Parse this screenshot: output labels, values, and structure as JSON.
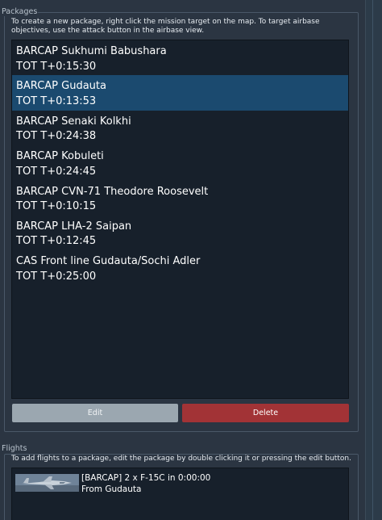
{
  "packages": {
    "group_title": "Packages",
    "hint": "To create a new package, right click the mission target on the map. To target airbase objectives, use the attack button in the airbase view.",
    "selected_index": 1,
    "items": [
      {
        "name": "BARCAP Sukhumi Babushara",
        "tot": "TOT T+0:15:30"
      },
      {
        "name": "BARCAP Gudauta",
        "tot": "TOT T+0:13:53"
      },
      {
        "name": "BARCAP Senaki Kolkhi",
        "tot": "TOT T+0:24:38"
      },
      {
        "name": "BARCAP Kobuleti",
        "tot": "TOT T+0:24:45"
      },
      {
        "name": "BARCAP CVN-71 Theodore Roosevelt",
        "tot": "TOT T+0:10:15"
      },
      {
        "name": "BARCAP LHA-2 Saipan",
        "tot": "TOT T+0:12:45"
      },
      {
        "name": "CAS Front line Gudauta/Sochi Adler",
        "tot": "TOT T+0:25:00"
      }
    ],
    "edit_label": "Edit",
    "delete_label": "Delete"
  },
  "flights": {
    "group_title": "Flights",
    "hint": "To add flights to a package, edit the package by double clicking it or pressing the edit button.",
    "items": [
      {
        "line1": "[BARCAP] 2 x F-15C in 0:00:00",
        "line2": "From Gudauta",
        "thumbnail_icon": "f-15c-aircraft-icon"
      }
    ]
  },
  "colors": {
    "background": "#2b3542",
    "list_background": "#17202b",
    "selected_row": "#1b4a6f",
    "edit_button": "#9ba7b0",
    "delete_button": "#a23336"
  }
}
